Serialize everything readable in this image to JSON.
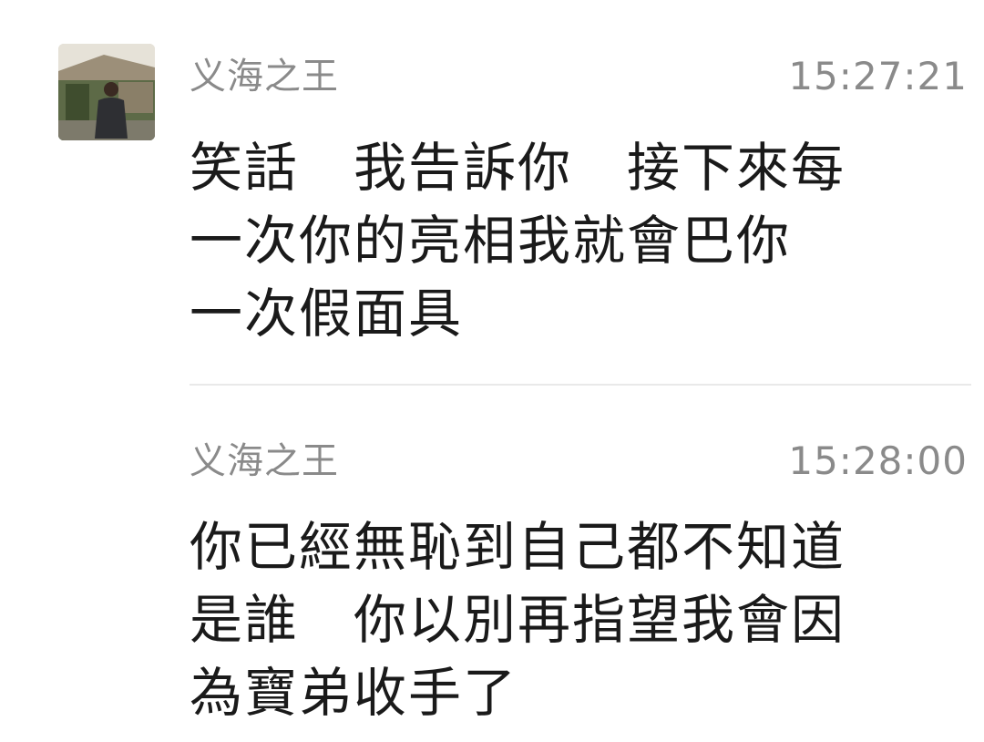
{
  "messages": [
    {
      "sender": "义海之王",
      "time": "15:27:21",
      "lines": [
        "笑話　我告訴你　接下來每",
        "一次你的亮相我就會巴你",
        "一次假面具"
      ],
      "avatar": "user-avatar"
    },
    {
      "sender": "义海之王",
      "time": "15:28:00",
      "lines": [
        "你已經無恥到自己都不知道",
        "是誰　你以別再指望我會因",
        "為寶弟收手了"
      ]
    }
  ],
  "colors": {
    "background": "#ffffff",
    "meta_text": "#8a8a8a",
    "body_text": "#1a1a1a",
    "divider": "#e9e9e9"
  }
}
